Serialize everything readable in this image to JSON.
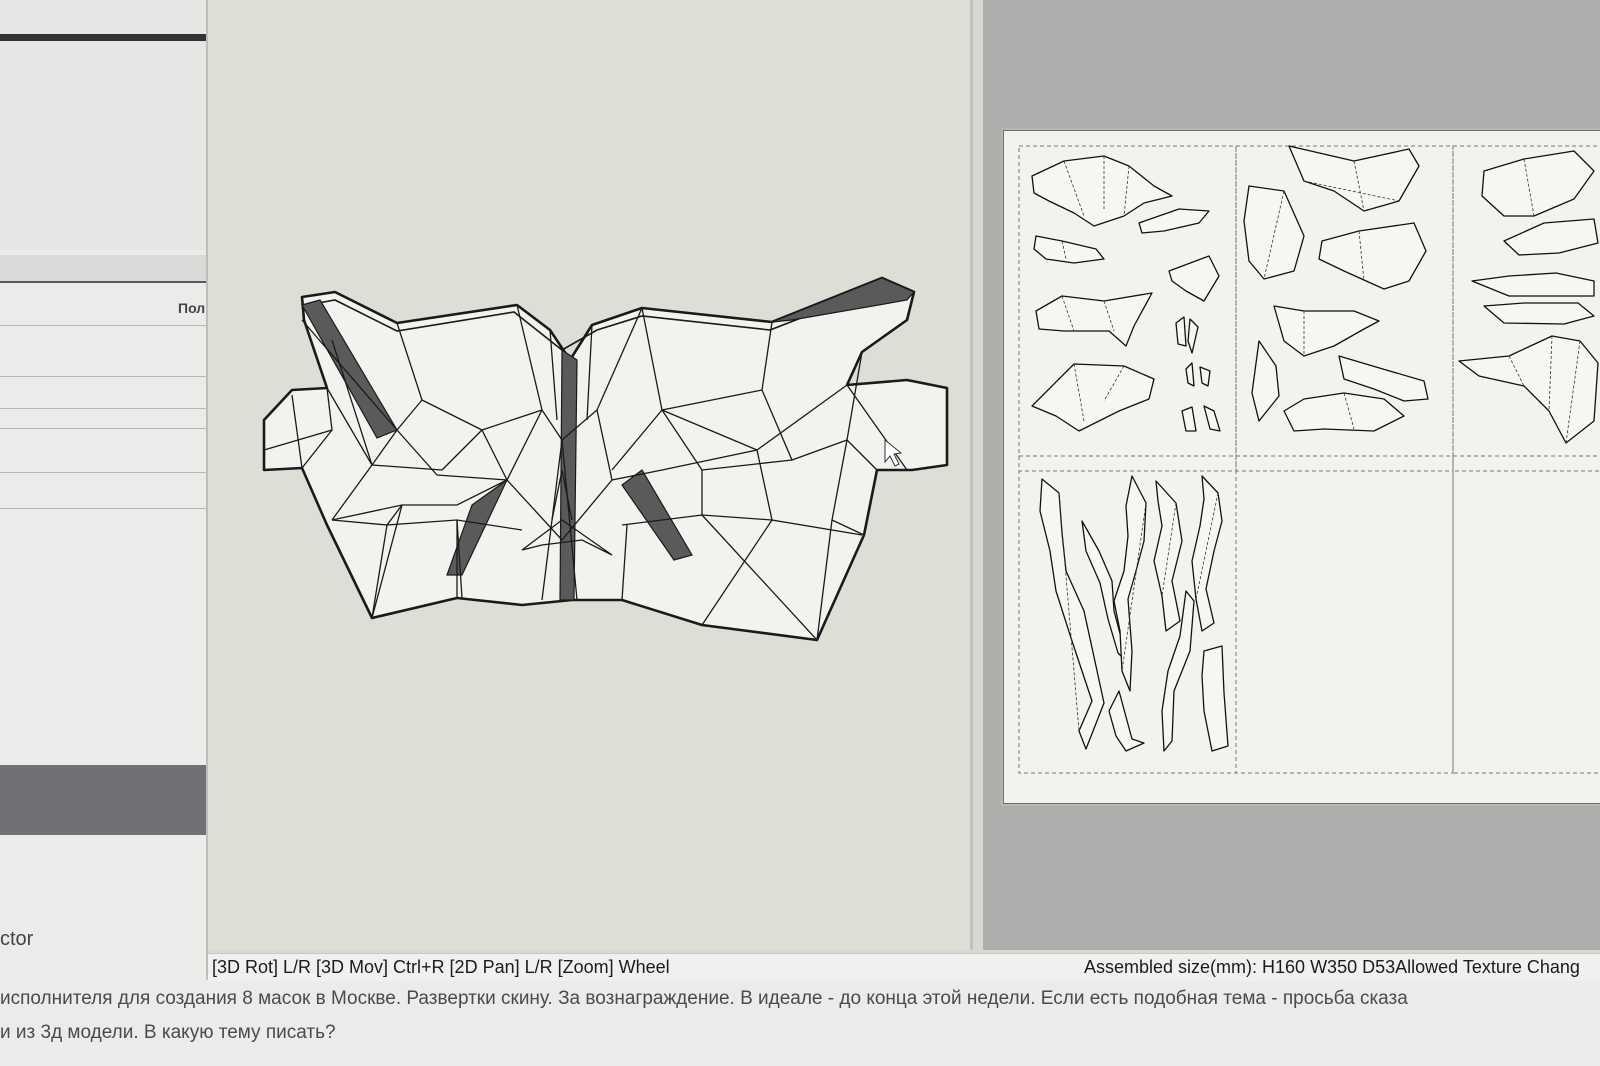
{
  "app": {
    "status_bar": {
      "controls_hint": "[3D Rot] L/R [3D Mov] Ctrl+R [2D Pan] L/R [Zoom] Wheel",
      "assembled_size": "Assembled size(mm): H160 W350 D53Allowed Texture Chang"
    },
    "viewport_3d": {
      "background": "#deded6",
      "model_fill": "#f2f2ee",
      "line_color": "#1a1a1a"
    },
    "viewport_2d": {
      "background": "#adadac",
      "sheet_color": "#f2f2ee",
      "page_border_color": "#777777"
    }
  },
  "forum": {
    "column_label": "Пол",
    "snippet": "ctor",
    "post_line1": "исполнителя для создания 8 масок в Москве. Развертки скину. За вознаграждение. В идеале - до конца этой недели. Если есть подобная тема - просьба сказа",
    "post_line2": "и из 3д модели. В какую тему писать?"
  }
}
